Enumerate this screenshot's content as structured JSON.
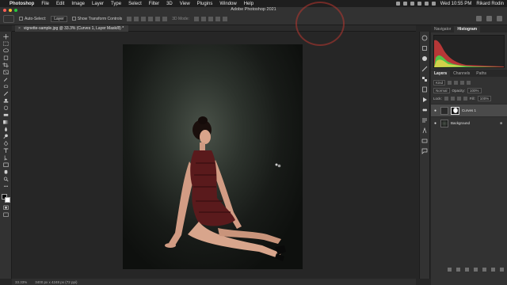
{
  "menubar": {
    "app_name": "Photoshop",
    "items": [
      "File",
      "Edit",
      "Image",
      "Layer",
      "Type",
      "Select",
      "Filter",
      "3D",
      "View",
      "Plugins",
      "Window",
      "Help"
    ],
    "clock": "Wed 10:55 PM",
    "user": "Rikard Rodin"
  },
  "window": {
    "title": "Adobe Photoshop 2021"
  },
  "options_bar": {
    "auto_select_label": "Auto-Select:",
    "auto_select_value": "Layer",
    "transform_controls_label": "Show Transform Controls",
    "mode_3d_label": "3D Mode:"
  },
  "document": {
    "tab_title": "vignette-sample.jpg @ 33.3% (Curves 1, Layer Mask/8) *",
    "close_glyph": "×"
  },
  "statusbar": {
    "zoom": "33.33%",
    "doc_info": "3400 px x 4248 px (72 ppi)"
  },
  "panels": {
    "top_tabs": [
      "Navigator",
      "Histogram"
    ],
    "top_active": "Histogram",
    "layer_tabs": [
      "Layers",
      "Channels",
      "Paths"
    ],
    "layer_active": "Layers",
    "kind_label": "Kind",
    "blend_mode": "Normal",
    "opacity_label": "Opacity:",
    "opacity_value": "100%",
    "lock_label": "Lock:",
    "fill_label": "Fill:",
    "fill_value": "100%",
    "layers": [
      {
        "name": "Curves 1",
        "selected": true
      },
      {
        "name": "Background",
        "selected": false
      }
    ]
  },
  "colors": {
    "accent_red": "#b8362f",
    "dress": "#5a1a1c",
    "hist_red": "#d13b3b",
    "hist_green": "#49d24a",
    "hist_yellow": "#e0d34a"
  },
  "icons": {
    "eye": "eye-icon",
    "lock": "lock-icon",
    "close": "close-icon"
  }
}
